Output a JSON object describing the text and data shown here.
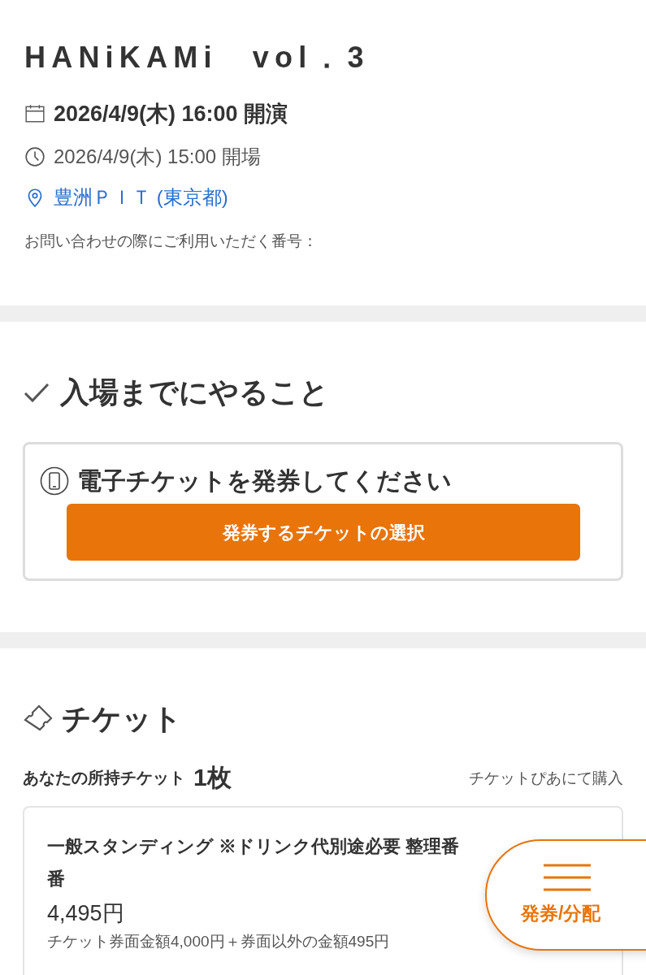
{
  "event": {
    "title": "HANiKAMi　vol．3",
    "start": "2026/4/9(木) 16:00 開演",
    "doors": "2026/4/9(木) 15:00 開場",
    "venue": "豊洲ＰＩＴ (東京都)",
    "inquiry_label": "お問い合わせの際にご利用いただく番号："
  },
  "todo": {
    "heading": "入場までにやること",
    "card_title": "電子チケットを発券してください",
    "button": "発券するチケットの選択"
  },
  "tickets": {
    "heading": "チケット",
    "owned_label": "あなたの所持チケット",
    "owned_count": "1枚",
    "purchase_link": "チケットぴあにて購入",
    "items": [
      {
        "name_line_1": "一般スタンディング ※ドリンク代別途必要 整理番",
        "name_line_2": "番",
        "price": "4,495円",
        "breakdown": "チケット券面金額4,000円＋券面以外の金額495円"
      }
    ]
  },
  "floating_button": {
    "label": "発券/分配"
  }
}
